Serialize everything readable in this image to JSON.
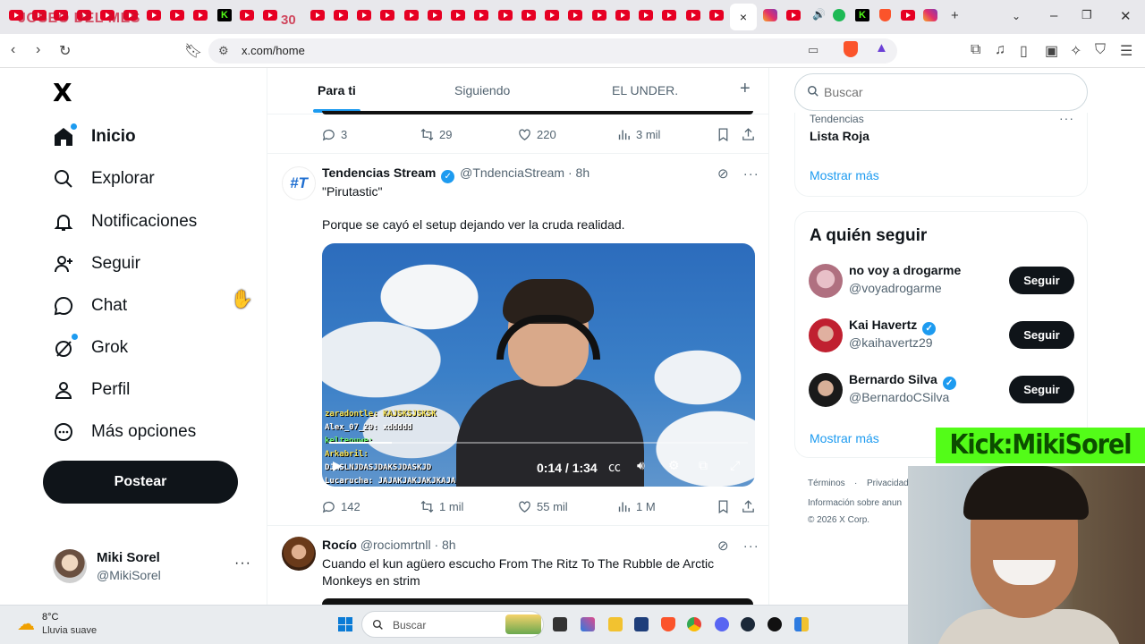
{
  "browser": {
    "overlay_title": "JOSEO DEL MES",
    "overlay_count": "30",
    "active_tab_close": "×",
    "new_tab": "+",
    "url": "x.com/home"
  },
  "sidebar": {
    "logo": "X",
    "items": [
      {
        "label": "Inicio",
        "icon": "home-icon"
      },
      {
        "label": "Explorar",
        "icon": "search-icon"
      },
      {
        "label": "Notificaciones",
        "icon": "bell-icon"
      },
      {
        "label": "Seguir",
        "icon": "person-add-icon"
      },
      {
        "label": "Chat",
        "icon": "chat-icon"
      },
      {
        "label": "Grok",
        "icon": "grok-icon"
      },
      {
        "label": "Perfil",
        "icon": "profile-icon"
      },
      {
        "label": "Más opciones",
        "icon": "more-circle-icon"
      }
    ],
    "post_button": "Postear",
    "account": {
      "name": "Miki Sorel",
      "handle": "@MikiSorel",
      "more": "···"
    }
  },
  "feed": {
    "tabs": [
      {
        "label": "Para ti",
        "active": true
      },
      {
        "label": "Siguiendo",
        "active": false
      },
      {
        "label": "EL UNDER.",
        "active": false
      }
    ],
    "add_tab": "+",
    "prev_tweet_actions": {
      "replies": "3",
      "reposts": "29",
      "likes": "220",
      "views": "3 mil"
    },
    "tweet1": {
      "name": "Tendencias Stream",
      "handle": "@TndenciaStream",
      "time": "8h",
      "text1": "\"Pirutastic\"",
      "text2": "Porque se cayó el setup dejando ver la cruda realidad.",
      "video": {
        "time": "0:14 / 1:34",
        "progress": 0.149,
        "chat_lines": [
          "zaradontle: KAJSKSJSKSK",
          "Alex_07_29: xddddd",
          "kelteouwe:",
          "Arkabril:",
          "DJASLNJDASJDAKSJDASKJD",
          "Lucarucha: JAJAKJAKJAKJKAJA"
        ]
      },
      "actions": {
        "replies": "142",
        "reposts": "1 mil",
        "likes": "55 mil",
        "views": "1 M"
      }
    },
    "tweet2": {
      "name": "Rocío",
      "handle": "@rociomrtnll",
      "time": "8h",
      "text": "Cuando el kun agüero escucho From The Ritz To The Rubble de Arctic Monkeys en strim"
    }
  },
  "right": {
    "search_placeholder": "Buscar",
    "trend": {
      "category": "Tendencias",
      "name": "Lista Roja",
      "more": "···"
    },
    "show_more": "Mostrar más",
    "who_to_follow_title": "A quién seguir",
    "follows": [
      {
        "name": "no voy a drogarme",
        "handle": "@voyadrogarme",
        "verified": false,
        "button": "Seguir"
      },
      {
        "name": "Kai Havertz",
        "handle": "@kaihavertz29",
        "verified": true,
        "button": "Seguir"
      },
      {
        "name": "Bernardo Silva",
        "handle": "@BernardoCSilva",
        "verified": true,
        "button": "Seguir"
      }
    ],
    "footer": {
      "terms": "Términos",
      "privacy": "Privacidad",
      "ads_info": "Información sobre anun",
      "copyright": "© 2026 X Corp."
    }
  },
  "stream_overlay": {
    "kick_banner": "Kick:MikiSorel"
  },
  "taskbar": {
    "temp": "8°C",
    "weather": "Lluvia suave",
    "search_placeholder": "Buscar"
  },
  "colors": {
    "accent": "#1d9bf0",
    "text": "#0f1419",
    "muted": "#536471",
    "kick": "#53fc18"
  }
}
